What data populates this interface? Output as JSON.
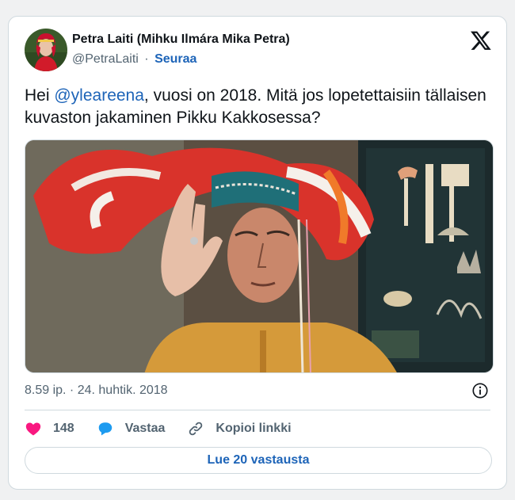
{
  "tweet": {
    "display_name": "Petra Laiti (Mihku Ilmára Mika Petra)",
    "handle": "@PetraLaiti",
    "separator": "·",
    "follow_label": "Seuraa",
    "text_before": "Hei ",
    "mention": "@yleareena",
    "text_after": ", vuosi on 2018. Mitä jos lopetettaisiin tällaisen kuvaston jakaminen Pikku Kakkosessa?",
    "timestamp": "8.59 ip. · 24. huhtik. 2018"
  },
  "actions": {
    "like_count": "148",
    "reply_label": "Vastaa",
    "copy_link_label": "Kopioi linkki"
  },
  "replies_button_label": "Lue 20 vastausta",
  "colors": {
    "link": "#1d64b8",
    "like": "#f91880",
    "text": "#0f1419",
    "muted": "#536471"
  },
  "icons": [
    "x-logo-icon",
    "info-icon",
    "heart-icon",
    "reply-bubble-icon",
    "link-icon"
  ]
}
